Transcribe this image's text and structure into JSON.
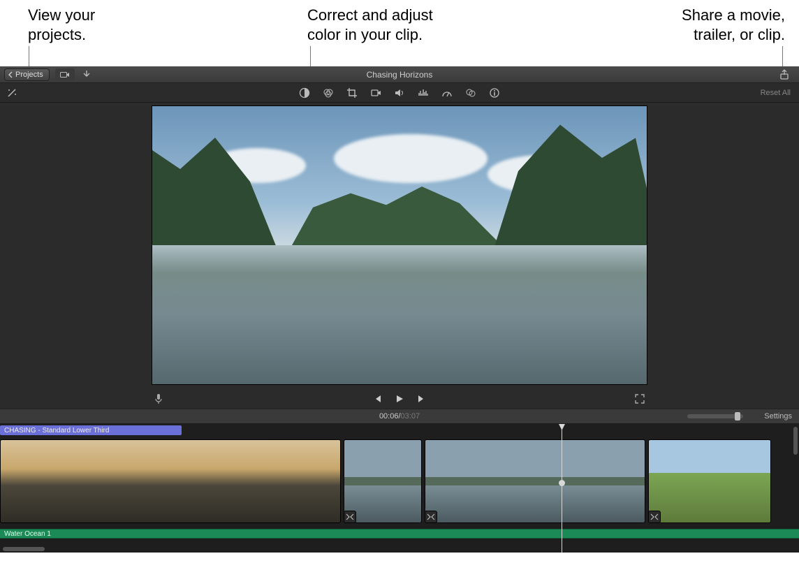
{
  "annotations": {
    "left": "View your\nprojects.",
    "mid": "Correct and adjust\ncolor in your clip.",
    "right": "Share a movie,\ntrailer, or clip."
  },
  "titlebar": {
    "projects_label": "Projects",
    "project_title": "Chasing Horizons"
  },
  "toolbar": {
    "reset_label": "Reset All",
    "icons": [
      "color-balance-icon",
      "color-correction-icon",
      "crop-icon",
      "stabilization-icon",
      "volume-icon",
      "noise-reduction-icon",
      "speed-icon",
      "filter-icon",
      "info-icon"
    ]
  },
  "playback": {
    "timecode_current": "00:06",
    "timecode_separator": " / ",
    "timecode_duration": "03:07"
  },
  "settings_label": "Settings",
  "timeline": {
    "title_clip_label": "CHASING - Standard Lower Third",
    "audio_track_label": "Water Ocean 1"
  }
}
